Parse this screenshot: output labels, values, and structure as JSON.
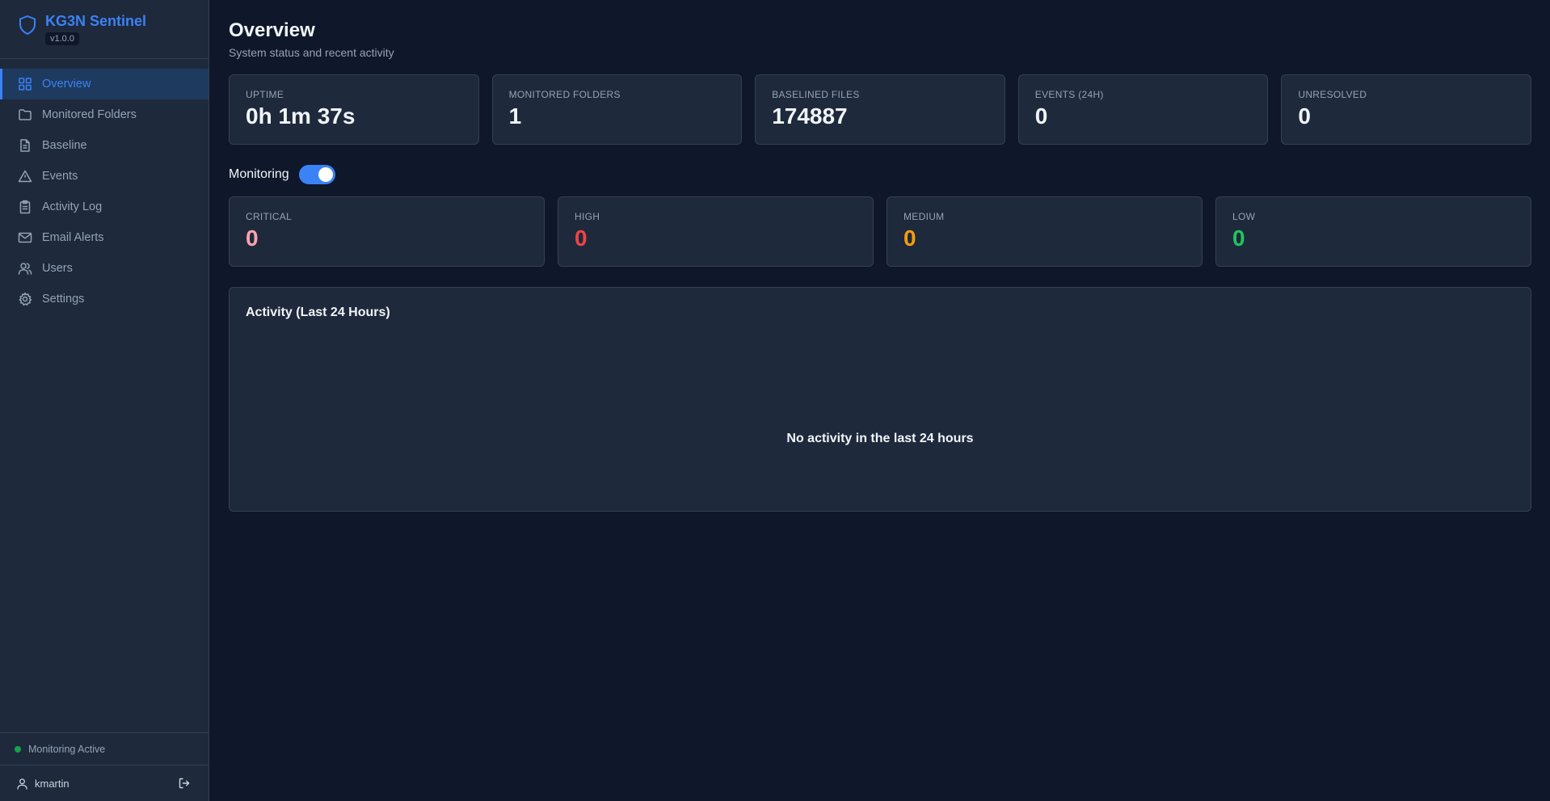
{
  "sidebar": {
    "brand_title": "KG3N Sentinel",
    "version": "v1.0.0",
    "items": [
      {
        "label": "Overview",
        "icon": "grid-icon"
      },
      {
        "label": "Monitored Folders",
        "icon": "folder-icon"
      },
      {
        "label": "Baseline",
        "icon": "file-icon"
      },
      {
        "label": "Events",
        "icon": "warning-icon"
      },
      {
        "label": "Activity Log",
        "icon": "clipboard-icon"
      },
      {
        "label": "Email Alerts",
        "icon": "mail-icon"
      },
      {
        "label": "Users",
        "icon": "users-icon"
      },
      {
        "label": "Settings",
        "icon": "gear-icon"
      }
    ],
    "active_item": "Overview",
    "status_text": "Monitoring Active",
    "username": "kmartin"
  },
  "header": {
    "title": "Overview",
    "subtitle": "System status and recent activity"
  },
  "stats": [
    {
      "label": "UPTIME",
      "value": "0h 1m 37s"
    },
    {
      "label": "MONITORED FOLDERS",
      "value": "1"
    },
    {
      "label": "BASELINED FILES",
      "value": "174887"
    },
    {
      "label": "EVENTS (24H)",
      "value": "0"
    },
    {
      "label": "UNRESOLVED",
      "value": "0"
    }
  ],
  "monitoring": {
    "label": "Monitoring",
    "enabled": true
  },
  "severity": [
    {
      "label": "CRITICAL",
      "value": "0",
      "color": "#fda4af"
    },
    {
      "label": "HIGH",
      "value": "0",
      "color": "#ef4444"
    },
    {
      "label": "MEDIUM",
      "value": "0",
      "color": "#f59e0b"
    },
    {
      "label": "LOW",
      "value": "0",
      "color": "#22c55e"
    }
  ],
  "activity": {
    "title": "Activity (Last 24 Hours)",
    "empty_message": "No activity in the last 24 hours"
  },
  "colors": {
    "accent": "#3b82f6",
    "background": "#0f172a",
    "panel": "#1e293b",
    "status_active": "#16a34a"
  }
}
